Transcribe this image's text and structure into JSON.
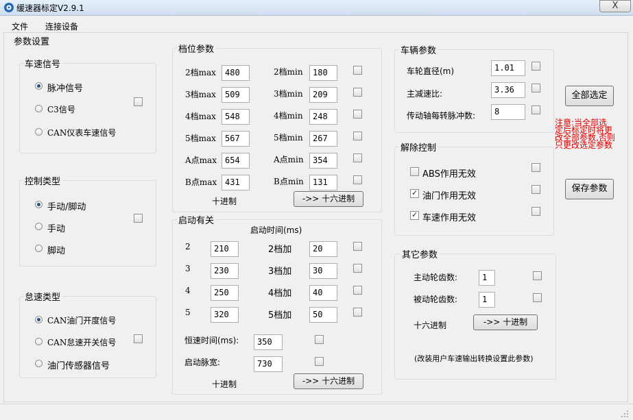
{
  "window": {
    "title": "缓速器标定V2.9.1",
    "close": "X"
  },
  "menu": {
    "file": "文件",
    "connect": "连接设备"
  },
  "params_title": "参数设置",
  "speed_signal": {
    "title": "车速信号",
    "options": [
      "脉冲信号",
      "C3信号",
      "CAN仪表车速信号"
    ],
    "selected": 0
  },
  "control_type": {
    "title": "控制类型",
    "options": [
      "手动/脚动",
      "手动",
      "脚动"
    ],
    "selected": 0
  },
  "idle_type": {
    "title": "怠速类型",
    "options": [
      "CAN油门开度信号",
      "CAN怠速开关信号",
      "油门传感器信号"
    ],
    "selected": 0
  },
  "gear": {
    "title": "档位参数",
    "rows": [
      {
        "max_label": "2档max",
        "max": "480",
        "min_label": "2档min",
        "min": "180"
      },
      {
        "max_label": "3档max",
        "max": "509",
        "min_label": "3档min",
        "min": "209"
      },
      {
        "max_label": "4档max",
        "max": "548",
        "min_label": "4档min",
        "min": "248"
      },
      {
        "max_label": "5档max",
        "max": "567",
        "min_label": "5档min",
        "min": "267"
      },
      {
        "max_label": "A点max",
        "max": "654",
        "min_label": "A点min",
        "min": "354"
      },
      {
        "max_label": "B点max",
        "max": "431",
        "min_label": "B点min",
        "min": "131"
      }
    ],
    "mode_label": "十进制",
    "convert_btn": "->> 十六进制"
  },
  "startup": {
    "title": "启动有关",
    "time_header": "启动时间(ms)",
    "rows": [
      {
        "label": "2",
        "value": "210",
        "add_label": "2档加",
        "add": "20"
      },
      {
        "label": "3",
        "value": "230",
        "add_label": "3档加",
        "add": "30"
      },
      {
        "label": "4",
        "value": "250",
        "add_label": "4档加",
        "add": "40"
      },
      {
        "label": "5",
        "value": "320",
        "add_label": "5档加",
        "add": "50"
      }
    ],
    "const_speed_label": "恒速时间(ms):",
    "const_speed": "350",
    "pulse_label": "启动脉宽:",
    "pulse": "730",
    "mode_label": "十进制",
    "convert_btn": "->> 十六进制"
  },
  "vehicle": {
    "title": "车辆参数",
    "wheel_label": "车轮直径(m)",
    "wheel": "1.01",
    "ratio_label": "主减速比:",
    "ratio": "3.36",
    "pulse_label": "传动轴每转脉冲数:",
    "pulse": "8"
  },
  "release": {
    "title": "解除控制",
    "items": [
      {
        "label": "ABS作用无效",
        "checked": false
      },
      {
        "label": "油门作用无效",
        "checked": true
      },
      {
        "label": "车速作用无效",
        "checked": true
      }
    ]
  },
  "other": {
    "title": "其它参数",
    "drive_label": "主动轮齿数:",
    "drive": "1",
    "driven_label": "被动轮齿数:",
    "driven": "1",
    "mode_label": "十六进制",
    "convert_btn": "->> 十进制",
    "note": "(改装用户车速输出转换设置此参数)"
  },
  "buttons": {
    "select_all": "全部选定",
    "save": "保存参数"
  },
  "warning": [
    "注意:当全部选",
    "定后标定时将更",
    "改全部参数,否则",
    "只更改选定参数"
  ],
  "colors": {
    "warning": "#e00000",
    "radio_dot": "#2b4f7a"
  }
}
